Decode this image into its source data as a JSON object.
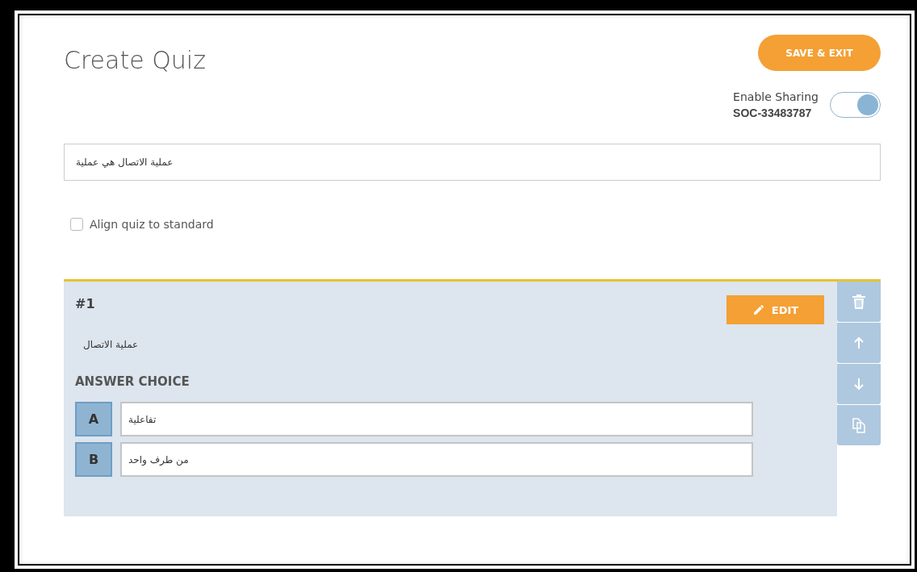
{
  "page_title": "Create Quiz",
  "save_button": "SAVE & EXIT",
  "sharing": {
    "label": "Enable Sharing",
    "code": "SOC-33483787",
    "on": true
  },
  "quiz_title": {
    "value": "عملية الاتصال هي عملية"
  },
  "align_standard": {
    "label": "Align quiz to standard",
    "checked": false
  },
  "questions": [
    {
      "number": "#1",
      "edit_label": "EDIT",
      "text": "عملية الاتصال",
      "answer_heading": "ANSWER CHOICE",
      "choices": [
        {
          "letter": "A",
          "value": "تفاعلية"
        },
        {
          "letter": "B",
          "value": "من طرف واحد"
        }
      ]
    }
  ]
}
